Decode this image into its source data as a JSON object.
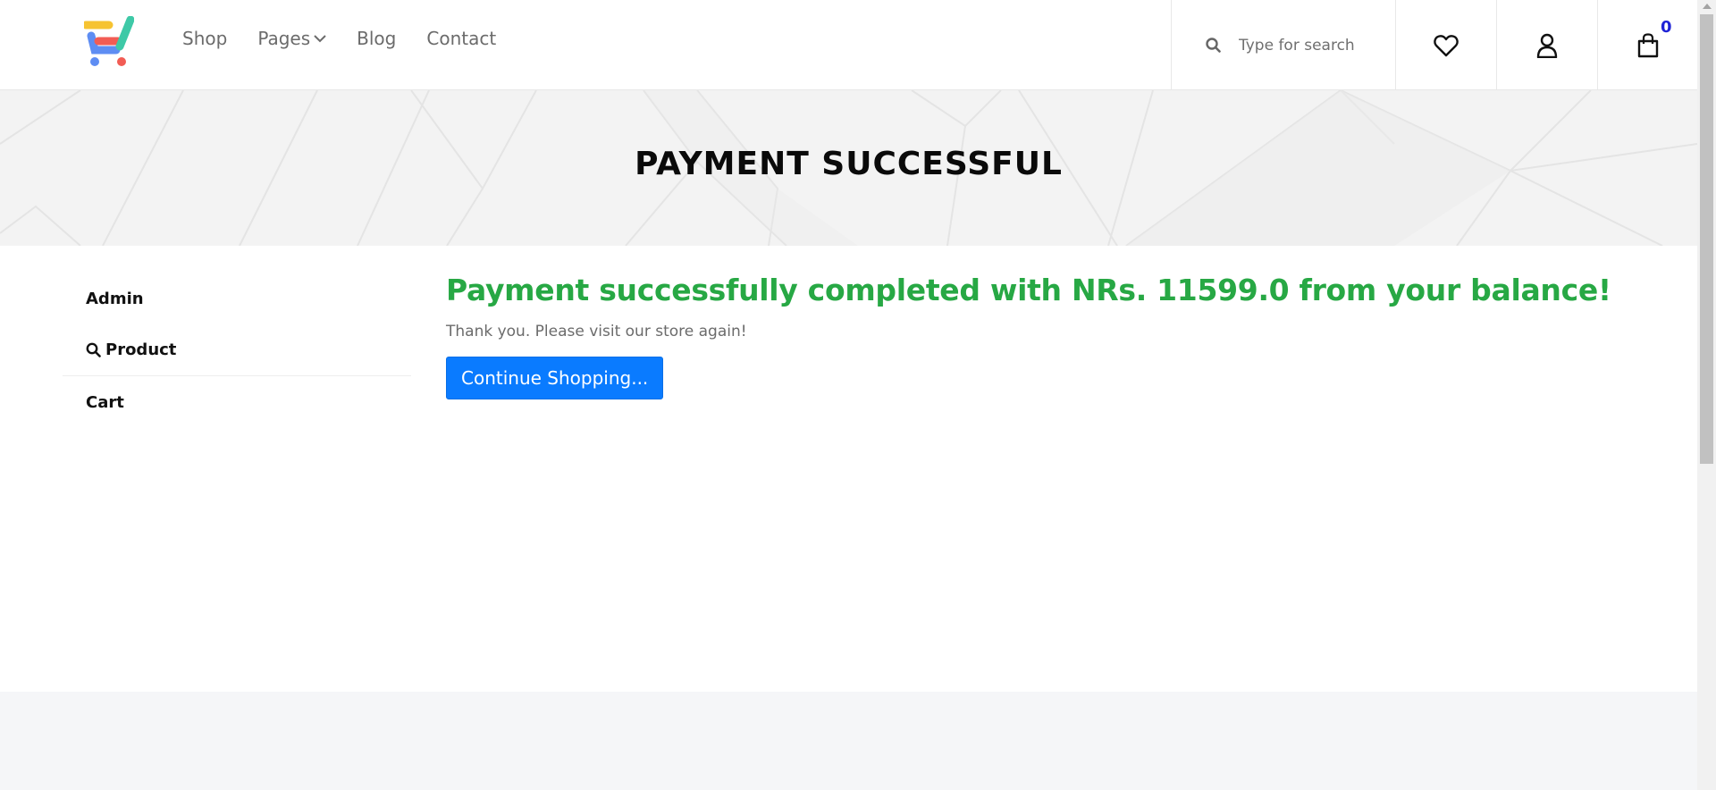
{
  "header": {
    "nav": [
      {
        "label": "Shop"
      },
      {
        "label": "Pages"
      },
      {
        "label": "Blog"
      },
      {
        "label": "Contact"
      }
    ],
    "search": {
      "placeholder": "Type for search"
    },
    "cart_count": "0"
  },
  "banner": {
    "title": "PAYMENT SUCCESSFUL"
  },
  "sidebar": {
    "items": [
      {
        "label": "Admin"
      },
      {
        "label": "Product"
      },
      {
        "label": "Cart"
      }
    ]
  },
  "main": {
    "success_message": "Payment successfully completed with NRs. 11599.0 from your balance!",
    "thanks_text": "Thank you. Please visit our store again!",
    "continue_button": "Continue Shopping..."
  },
  "colors": {
    "success": "#27a844",
    "button": "#0a7bff",
    "cart_badge": "#1f23d6"
  },
  "icons": [
    "logo-cart-icon",
    "chevron-down-icon",
    "search-icon",
    "heart-icon",
    "user-icon",
    "shopping-bag-icon"
  ]
}
